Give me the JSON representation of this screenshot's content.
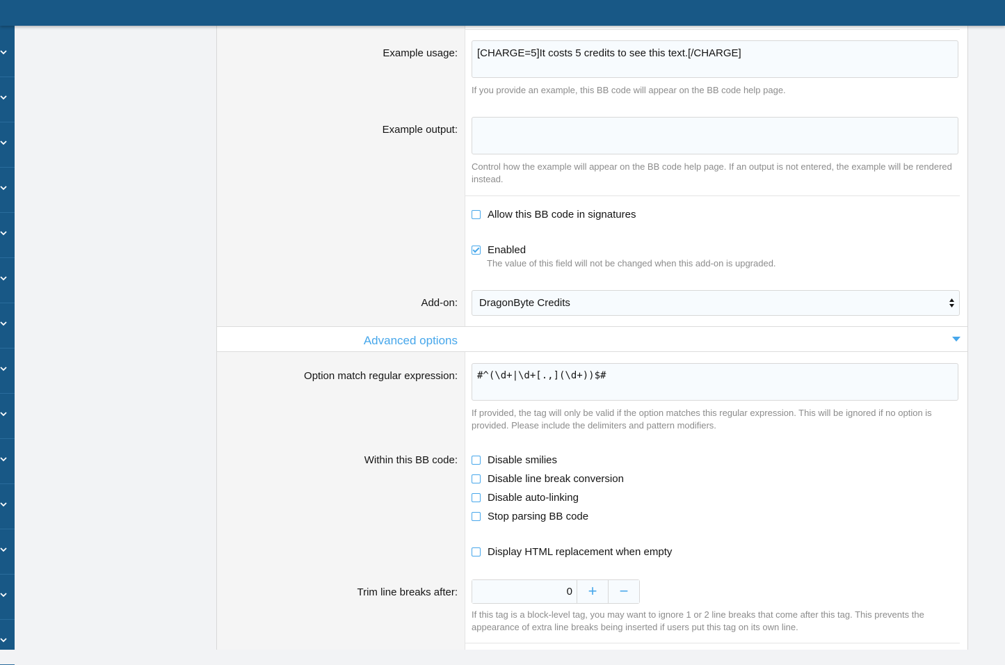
{
  "form": {
    "example_usage": {
      "label": "Example usage:",
      "value": "[CHARGE=5]It costs 5 credits to see this text.[/CHARGE]",
      "hint": "If you provide an example, this BB code will appear on the BB code help page."
    },
    "example_output": {
      "label": "Example output:",
      "value": "",
      "hint": "Control how the example will appear on the BB code help page. If an output is not entered, the example will be rendered instead."
    },
    "allow_signatures": {
      "label": "Allow this BB code in signatures",
      "checked": false
    },
    "enabled": {
      "label": "Enabled",
      "checked": true,
      "hint": "The value of this field will not be changed when this add-on is upgraded."
    },
    "addon": {
      "label": "Add-on:",
      "value": "DragonByte Credits"
    },
    "advanced_options": {
      "title": "Advanced options"
    },
    "option_regex": {
      "label": "Option match regular expression:",
      "value": "#^(\\d+|\\d+[.,](\\d+))$#",
      "hint": "If provided, the tag will only be valid if the option matches this regular expression. This will be ignored if no option is provided. Please include the delimiters and pattern modifiers."
    },
    "within_bbcode": {
      "label": "Within this BB code:",
      "options": [
        {
          "label": "Disable smilies",
          "checked": false
        },
        {
          "label": "Disable line break conversion",
          "checked": false
        },
        {
          "label": "Disable auto-linking",
          "checked": false
        },
        {
          "label": "Stop parsing BB code",
          "checked": false
        }
      ]
    },
    "display_html_empty": {
      "label": "Display HTML replacement when empty",
      "checked": false
    },
    "trim_line_breaks": {
      "label": "Trim line breaks after:",
      "value": "0",
      "plus": "+",
      "minus": "−",
      "hint": "If this tag is a block-level tag, you may want to ignore 1 or 2 line breaks that come after this tag. This prevents the appearance of extra line breaks being inserted if users put this tag on its own line."
    }
  },
  "colors": {
    "header": "#185886",
    "accent": "#47a7eb",
    "hint_text": "#8c8c8c"
  }
}
